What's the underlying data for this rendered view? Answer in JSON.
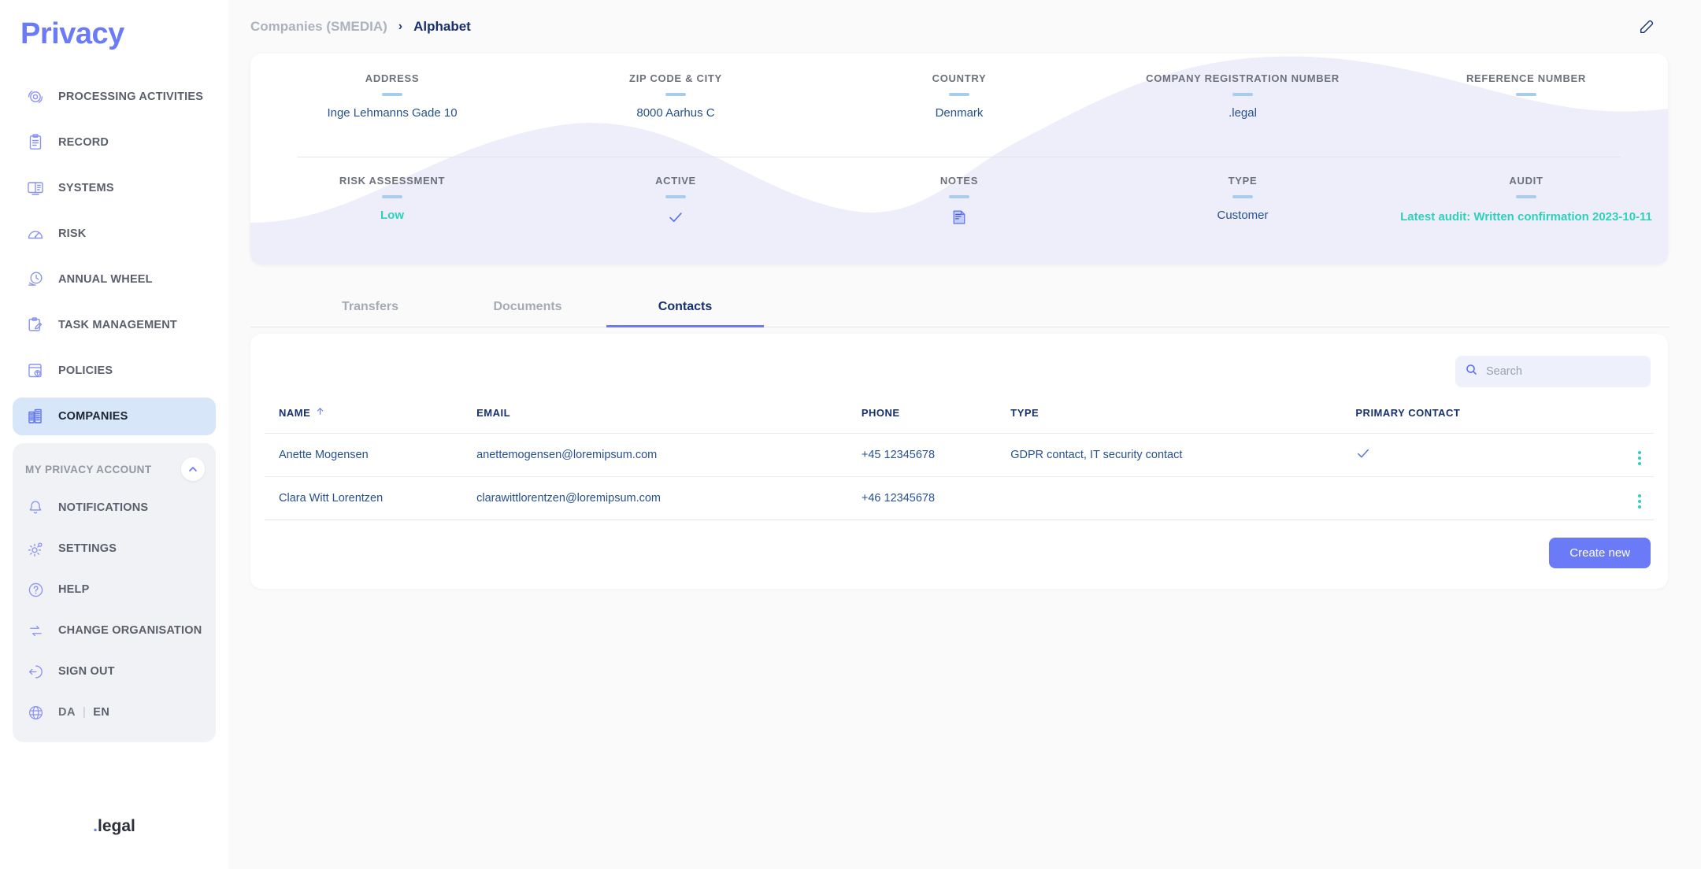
{
  "brand": {
    "name": "Privacy",
    "footer_prefix": ".",
    "footer_text": "legal"
  },
  "sidebar": {
    "main_items": [
      {
        "label": "PROCESSING ACTIVITIES",
        "icon": "target-refresh-icon",
        "active": false
      },
      {
        "label": "RECORD",
        "icon": "clipboard-icon",
        "active": false
      },
      {
        "label": "SYSTEMS",
        "icon": "monitor-list-icon",
        "active": false
      },
      {
        "label": "RISK",
        "icon": "gauge-icon",
        "active": false
      },
      {
        "label": "ANNUAL WHEEL",
        "icon": "clock-icon",
        "active": false
      },
      {
        "label": "TASK MANAGEMENT",
        "icon": "task-clipboard-icon",
        "active": false
      },
      {
        "label": "POLICIES",
        "icon": "policy-doc-icon",
        "active": false
      },
      {
        "label": "COMPANIES",
        "icon": "buildings-icon",
        "active": true
      }
    ],
    "account": {
      "title": "MY PRIVACY ACCOUNT",
      "collapse_icon": "chevron-up-icon",
      "items": [
        {
          "label": "NOTIFICATIONS",
          "icon": "bell-icon"
        },
        {
          "label": "SETTINGS",
          "icon": "gear-icon"
        },
        {
          "label": "HELP",
          "icon": "question-circle-icon"
        },
        {
          "label": "CHANGE ORGANISATION",
          "icon": "swap-arrows-icon"
        },
        {
          "label": "SIGN OUT",
          "icon": "sign-out-icon"
        }
      ],
      "language": {
        "icon": "globe-icon",
        "da": "DA",
        "separator": "|",
        "en": "EN"
      }
    }
  },
  "header": {
    "breadcrumb_parent": "Companies (SMEDIA)",
    "breadcrumb_separator": "›",
    "breadcrumb_current": "Alphabet",
    "edit_icon": "edit-pencil-icon"
  },
  "info_card": {
    "row1": [
      {
        "label": "ADDRESS",
        "value": "Inge Lehmanns Gade 10"
      },
      {
        "label": "ZIP CODE & CITY",
        "value": "8000 Aarhus C"
      },
      {
        "label": "COUNTRY",
        "value": "Denmark"
      },
      {
        "label": "COMPANY REGISTRATION NUMBER",
        "value": ".legal"
      },
      {
        "label": "REFERENCE NUMBER",
        "value": ""
      }
    ],
    "row2": [
      {
        "label": "RISK ASSESSMENT",
        "value": "Low",
        "style": "risk-low"
      },
      {
        "label": "ACTIVE",
        "value": "",
        "icon": "check-icon"
      },
      {
        "label": "NOTES",
        "value": "",
        "icon": "note-icon"
      },
      {
        "label": "TYPE",
        "value": "Customer"
      },
      {
        "label": "AUDIT",
        "value": "Latest audit: Written confirmation 2023-10-11",
        "style": "audit"
      }
    ]
  },
  "tabs": [
    {
      "label": "Transfers",
      "active": false
    },
    {
      "label": "Documents",
      "active": false
    },
    {
      "label": "Contacts",
      "active": true
    }
  ],
  "contacts_panel": {
    "search": {
      "placeholder": "Search",
      "value": "",
      "icon": "search-icon"
    },
    "columns": [
      {
        "key": "name",
        "label": "NAME",
        "sort_icon": "arrow-up-icon"
      },
      {
        "key": "email",
        "label": "EMAIL"
      },
      {
        "key": "phone",
        "label": "PHONE"
      },
      {
        "key": "type",
        "label": "TYPE"
      },
      {
        "key": "primary",
        "label": "PRIMARY CONTACT"
      }
    ],
    "rows": [
      {
        "name": "Anette Mogensen",
        "email": "anettemogensen@loremipsum.com",
        "phone": "+45 12345678",
        "type": "GDPR contact, IT security contact",
        "primary": true,
        "menu_icon": "kebab-menu-icon"
      },
      {
        "name": "Clara Witt Lorentzen",
        "email": "clarawittlorentzen@loremipsum.com",
        "phone": "+46 12345678",
        "type": "",
        "primary": false,
        "menu_icon": "kebab-menu-icon"
      }
    ],
    "create_button": "Create new"
  },
  "colors": {
    "accent": "#6b7bf7",
    "teal": "#2fd0bb",
    "navy": "#16306e",
    "value_blue": "#27508f",
    "sidebar_active_bg": "#d7e6f8"
  }
}
